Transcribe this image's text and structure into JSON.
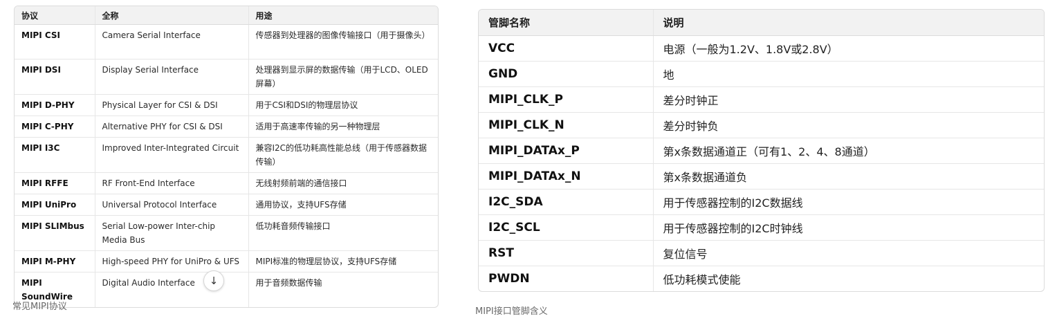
{
  "protocols": {
    "headers": [
      "协议",
      "全称",
      "用途"
    ],
    "rows": [
      {
        "name": "MIPI CSI",
        "full": "Camera Serial Interface",
        "use": "传感器到处理器的图像传输接口（用于摄像头）"
      },
      {
        "name": "MIPI DSI",
        "full": "Display Serial Interface",
        "use": "处理器到显示屏的数据传输（用于LCD、OLED屏幕）"
      },
      {
        "name": "MIPI D-PHY",
        "full": "Physical Layer for CSI & DSI",
        "use": "用于CSI和DSI的物理层协议"
      },
      {
        "name": "MIPI C-PHY",
        "full": "Alternative PHY for CSI & DSI",
        "use": "适用于高速率传输的另一种物理层"
      },
      {
        "name": "MIPI I3C",
        "full": "Improved Inter-Integrated Circuit",
        "use": "兼容I2C的低功耗高性能总线（用于传感器数据传输）"
      },
      {
        "name": "MIPI RFFE",
        "full": "RF Front-End Interface",
        "use": "无线射频前端的通信接口"
      },
      {
        "name": "MIPI UniPro",
        "full": "Universal Protocol Interface",
        "use": "通用协议，支持UFS存储"
      },
      {
        "name": "MIPI SLIMbus",
        "full": "Serial Low-power Inter-chip Media Bus",
        "use": "低功耗音频传输接口"
      },
      {
        "name": "MIPI M-PHY",
        "full": "High-speed PHY for UniPro & UFS",
        "use": "MIPI标准的物理层协议，支持UFS存储"
      },
      {
        "name": "MIPI SoundWire",
        "full": "Digital Audio Interface",
        "use": "用于音频数据传输"
      }
    ],
    "scroll_icon": "arrow-down-icon",
    "scroll_glyph": "↓",
    "caption": "常见MIPI协议"
  },
  "pins": {
    "headers": [
      "管脚名称",
      "说明"
    ],
    "rows": [
      {
        "name": "VCC",
        "desc": "电源（一般为1.2V、1.8V或2.8V）"
      },
      {
        "name": "GND",
        "desc": "地"
      },
      {
        "name": "MIPI_CLK_P",
        "desc": "差分时钟正"
      },
      {
        "name": "MIPI_CLK_N",
        "desc": "差分时钟负"
      },
      {
        "name": "MIPI_DATAx_P",
        "desc": "第x条数据通道正（可有1、2、4、8通道）"
      },
      {
        "name": "MIPI_DATAx_N",
        "desc": "第x条数据通道负"
      },
      {
        "name": "I2C_SDA",
        "desc": "用于传感器控制的I2C数据线"
      },
      {
        "name": "I2C_SCL",
        "desc": "用于传感器控制的I2C时钟线"
      },
      {
        "name": "RST",
        "desc": "复位信号"
      },
      {
        "name": "PWDN",
        "desc": "低功耗模式使能"
      }
    ],
    "caption": "MIPI接口管脚含义"
  }
}
